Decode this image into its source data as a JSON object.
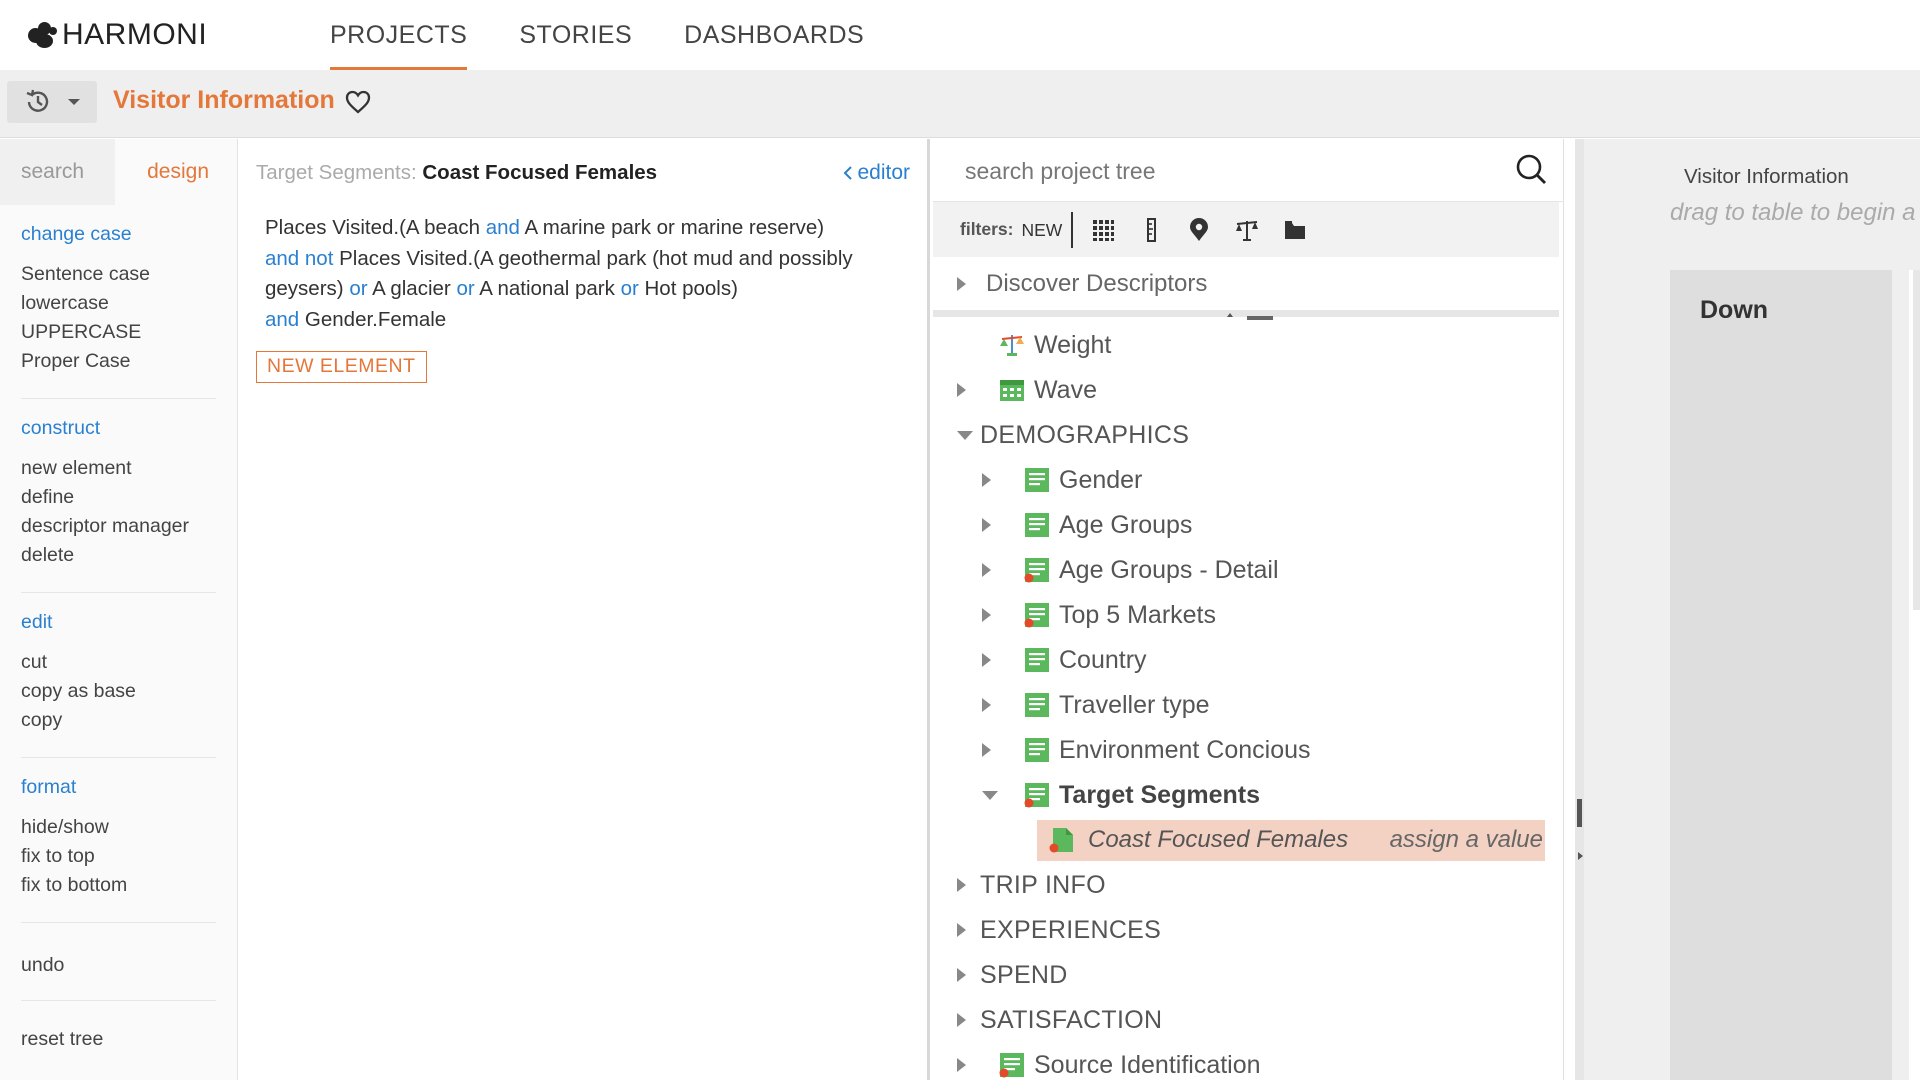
{
  "app": {
    "logo_text": "HARMONI"
  },
  "nav": {
    "tabs": [
      "PROJECTS",
      "STORIES",
      "DASHBOARDS"
    ],
    "active": "PROJECTS"
  },
  "title_bar": {
    "title": "Visitor Information"
  },
  "left_menu": {
    "tabs": [
      "search",
      "design"
    ],
    "active_tab": "design",
    "sections": [
      {
        "heading": "change case",
        "items": [
          "Sentence case",
          "lowercase",
          "UPPERCASE",
          "Proper Case"
        ]
      },
      {
        "heading": "construct",
        "items": [
          "new element",
          "define",
          "descriptor manager",
          "delete"
        ]
      },
      {
        "heading": "edit",
        "items": [
          "cut",
          "copy as base",
          "copy"
        ]
      },
      {
        "heading": "format",
        "items": [
          "hide/show",
          "fix to top",
          "fix to bottom"
        ]
      },
      {
        "heading": "",
        "items": [
          "undo"
        ]
      },
      {
        "heading": "",
        "items": [
          "reset tree"
        ]
      }
    ]
  },
  "editor": {
    "label": "Target Segments:",
    "segment": "Coast Focused Females",
    "link": "editor",
    "expression": [
      {
        "t": "Places Visited.(A beach ",
        "op": false
      },
      {
        "t": "and",
        "op": true
      },
      {
        "t": " A marine park or marine reserve)",
        "op": false
      },
      {
        "t": "\n",
        "op": false
      },
      {
        "t": "and not",
        "op": true
      },
      {
        "t": " Places Visited.(A geothermal park (hot mud and possibly geysers) ",
        "op": false
      },
      {
        "t": "or",
        "op": true
      },
      {
        "t": " A glacier ",
        "op": false
      },
      {
        "t": "or",
        "op": true
      },
      {
        "t": " A national park ",
        "op": false
      },
      {
        "t": "or",
        "op": true
      },
      {
        "t": " Hot pools)",
        "op": false
      },
      {
        "t": "\n",
        "op": false
      },
      {
        "t": "and",
        "op": true
      },
      {
        "t": " Gender.Female",
        "op": false
      }
    ],
    "new_element_label": "NEW ELEMENT"
  },
  "tree": {
    "search_placeholder": "search project tree",
    "filters_label": "filters:",
    "filters_new": "NEW",
    "filter_icons": [
      "grid-icon",
      "ruler-icon",
      "map-pin-icon",
      "scales-icon",
      "folder-icon"
    ],
    "discover_label": "Discover Descriptors",
    "rows": [
      {
        "label": "Weight",
        "level": 1,
        "toggle": "none",
        "icon": "scales-icon",
        "style": "normal"
      },
      {
        "label": "Wave",
        "level": 1,
        "toggle": "right",
        "icon": "calendar-icon",
        "style": "normal"
      },
      {
        "label": "DEMOGRAPHICS",
        "level": 0,
        "toggle": "down",
        "icon": "",
        "style": "section"
      },
      {
        "label": "Gender",
        "level": 2,
        "toggle": "right",
        "icon": "list-icon",
        "style": "normal"
      },
      {
        "label": "Age Groups",
        "level": 2,
        "toggle": "right",
        "icon": "list-icon",
        "style": "normal"
      },
      {
        "label": "Age Groups - Detail",
        "level": 2,
        "toggle": "right",
        "icon": "list-derived-icon",
        "style": "normal"
      },
      {
        "label": "Top 5 Markets",
        "level": 2,
        "toggle": "right",
        "icon": "list-derived-icon",
        "style": "normal"
      },
      {
        "label": "Country",
        "level": 2,
        "toggle": "right",
        "icon": "list-icon",
        "style": "normal"
      },
      {
        "label": "Traveller type",
        "level": 2,
        "toggle": "right",
        "icon": "list-icon",
        "style": "normal"
      },
      {
        "label": "Environment Concious",
        "level": 2,
        "toggle": "right",
        "icon": "list-icon",
        "style": "normal"
      },
      {
        "label": "Target Segments",
        "level": 2,
        "toggle": "down",
        "icon": "list-derived-icon",
        "style": "bold"
      },
      {
        "label": "Coast Focused Females",
        "level": 3,
        "toggle": "none",
        "icon": "element-derived-icon",
        "style": "selected",
        "action": "assign a value"
      },
      {
        "label": "TRIP INFO",
        "level": 0,
        "toggle": "right",
        "icon": "",
        "style": "section"
      },
      {
        "label": "EXPERIENCES",
        "level": 0,
        "toggle": "right",
        "icon": "",
        "style": "section"
      },
      {
        "label": "SPEND",
        "level": 0,
        "toggle": "right",
        "icon": "",
        "style": "section"
      },
      {
        "label": "SATISFACTION",
        "level": 0,
        "toggle": "right",
        "icon": "",
        "style": "section"
      },
      {
        "label": "Source Identification",
        "level": 1,
        "toggle": "right",
        "icon": "list-derived-icon",
        "style": "normal"
      }
    ]
  },
  "right_panel": {
    "title": "Visitor Information",
    "hint": "drag to table to begin a",
    "column_label": "Down"
  },
  "colors": {
    "accent": "#e4773a",
    "link": "#2a80d0",
    "icon_green": "#5cb85c",
    "icon_red": "#e24a2a",
    "selected_row": "#f3d1c3"
  }
}
